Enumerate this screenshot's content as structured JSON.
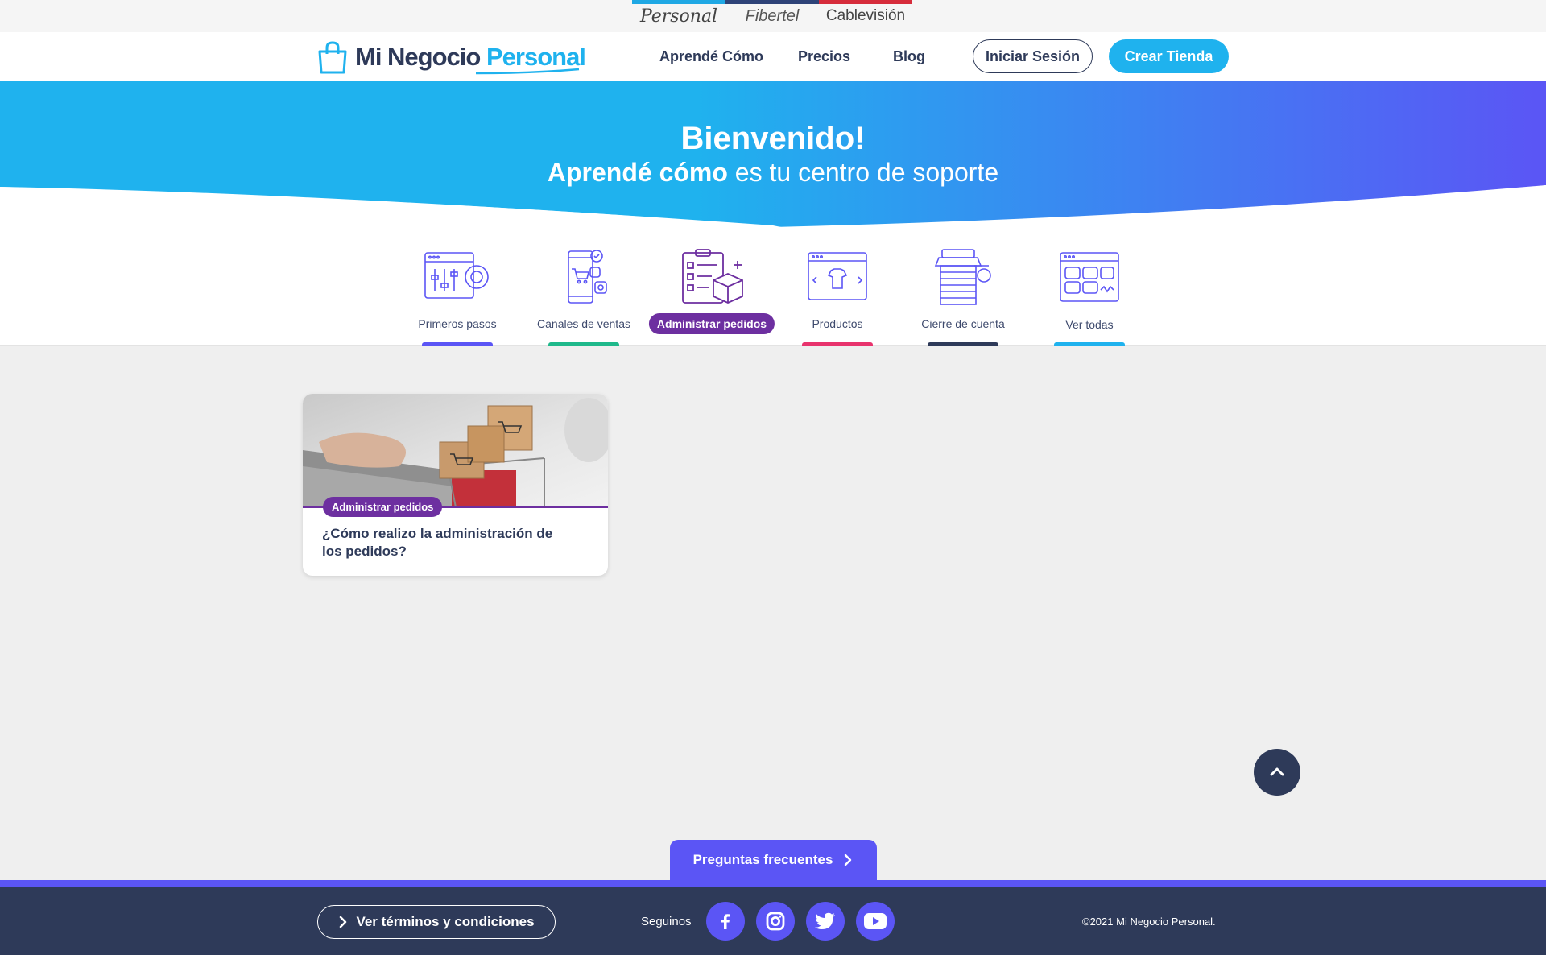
{
  "brands": [
    "Personal",
    "Fibertel",
    "Cablevisión"
  ],
  "logo": {
    "part1": "Mi Negocio",
    "part2": "Personal"
  },
  "nav": {
    "learn": "Aprendé Cómo",
    "pricing": "Precios",
    "blog": "Blog"
  },
  "auth": {
    "login": "Iniciar Sesión",
    "create_store": "Crear Tienda"
  },
  "hero": {
    "title": "Bienvenido!",
    "sub_bold": "Aprendé cómo",
    "sub_rest": "es tu centro de soporte"
  },
  "categories": [
    {
      "label": "Primeros pasos",
      "color": "#5b55f5"
    },
    {
      "label": "Canales de ventas",
      "color": "#1fb98b"
    },
    {
      "label": "Administrar pedidos",
      "color": "#6d2fa0",
      "active": true
    },
    {
      "label": "Productos",
      "color": "#e8336d"
    },
    {
      "label": "Cierre de cuenta",
      "color": "#2e3a59"
    },
    {
      "label": "Ver todas",
      "color": "#1fb2ee"
    }
  ],
  "card": {
    "tag": "Administrar pedidos",
    "title": "¿Cómo realizo la administración de los pedidos?"
  },
  "faq": {
    "label": "Preguntas frecuentes"
  },
  "footer": {
    "terms": "Ver términos y condiciones",
    "follow": "Seguinos",
    "social": [
      "facebook-icon",
      "instagram-icon",
      "twitter-icon",
      "youtube-icon"
    ],
    "copyright": "©2021 Mi Negocio Personal."
  },
  "colors": {
    "primary": "#1fb2ee",
    "violet": "#5b55f5",
    "navy": "#2e3a59",
    "purple": "#6d2fa0"
  }
}
